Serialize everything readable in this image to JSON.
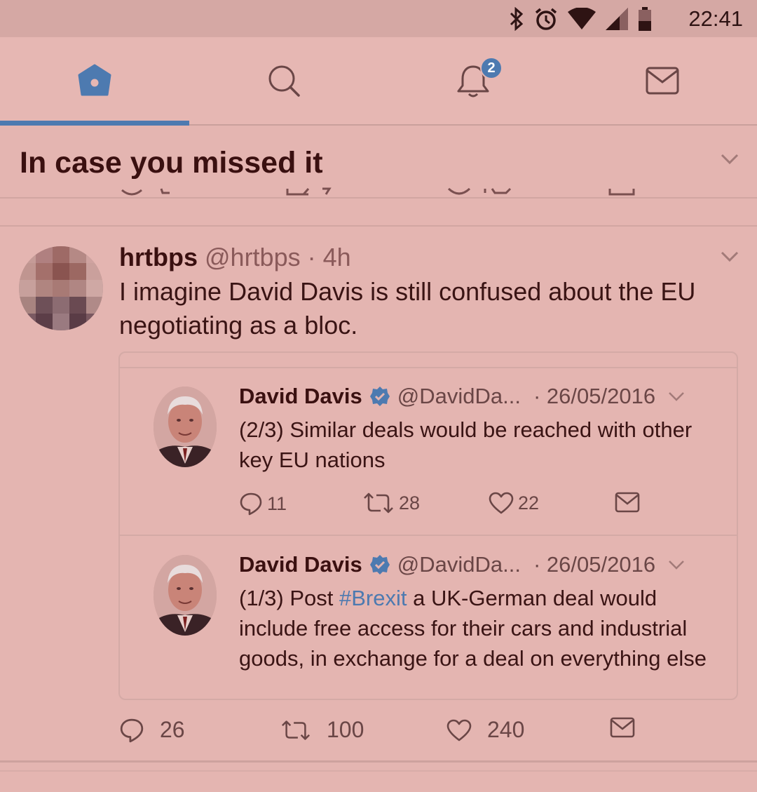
{
  "status_bar": {
    "time": "22:41",
    "icons": [
      "bluetooth-icon",
      "alarm-icon",
      "wifi-icon",
      "signal-icon",
      "battery-icon"
    ]
  },
  "nav": {
    "tabs": [
      {
        "name": "home",
        "icon": "home-icon",
        "active": true
      },
      {
        "name": "search",
        "icon": "search-icon",
        "active": false
      },
      {
        "name": "notifications",
        "icon": "bell-icon",
        "active": false,
        "badge": "2"
      },
      {
        "name": "messages",
        "icon": "mail-icon",
        "active": false
      }
    ],
    "accent": "#4d7ab0"
  },
  "section": {
    "title": "In case you missed it"
  },
  "tweet": {
    "display_name": "hrtbps",
    "handle_time": "@hrtbps · 4h",
    "text": "I imagine David Davis is still confused about the EU negotiating as a bloc.",
    "replies": "26",
    "retweets": "100",
    "likes": "240"
  },
  "quoted": [
    {
      "display_name": "David Davis",
      "handle": "@DavidDa...",
      "date": "· 26/05/2016",
      "text": "(2/3) Similar deals would be reached with other key EU nations",
      "replies": "11",
      "retweets": "28",
      "likes": "22"
    },
    {
      "display_name": "David Davis",
      "handle": "@DavidDa...",
      "date": "· 26/05/2016",
      "text_before": "(1/3) Post ",
      "hashtag": "#Brexit",
      "text_after": " a UK-German deal would include free access for their cars and industrial goods, in exchange for a deal on everything else"
    }
  ]
}
